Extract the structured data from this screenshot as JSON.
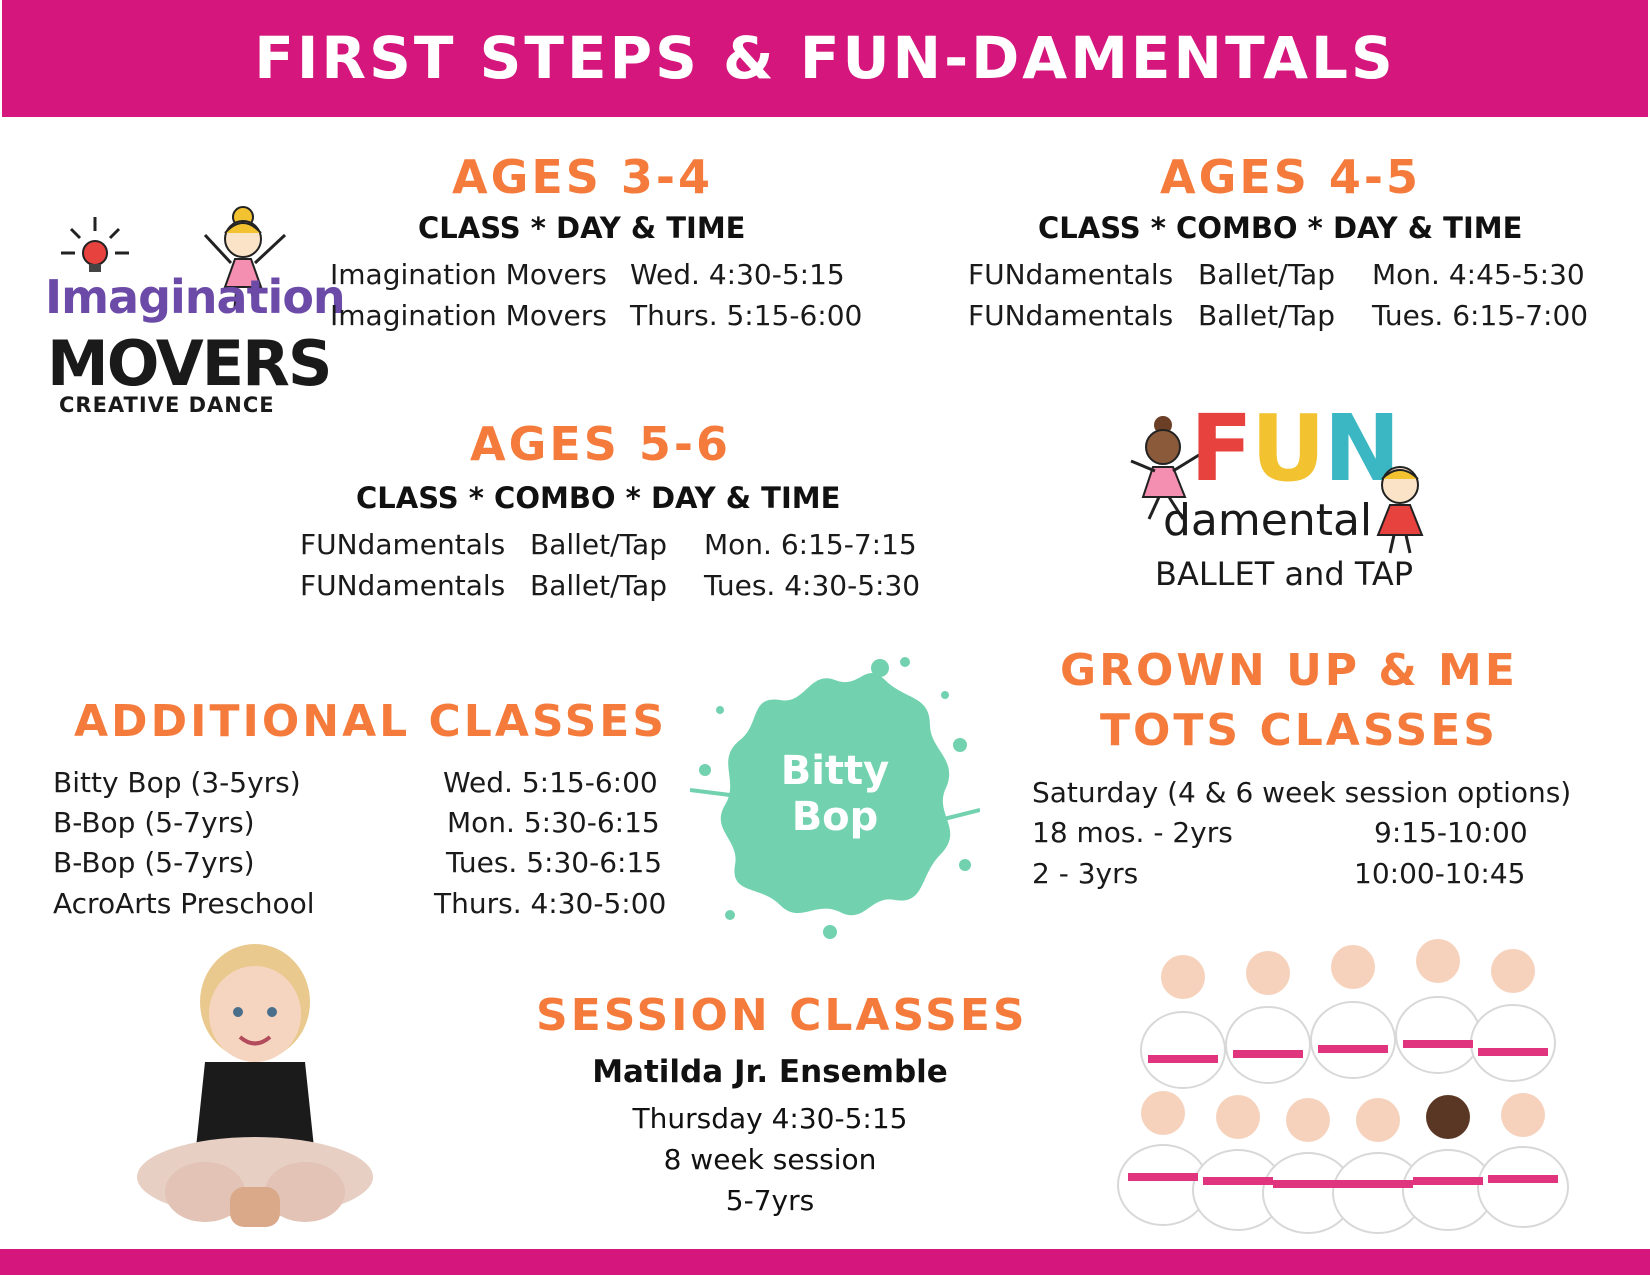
{
  "header": {
    "title": "FIRST STEPS & FUN-DAMENTALS"
  },
  "ages34": {
    "heading": "AGES 3-4",
    "subheading": "CLASS * DAY & TIME",
    "rows": [
      {
        "class": "Imagination Movers",
        "day_time": "Wed. 4:30-5:15"
      },
      {
        "class": "Imagination Movers",
        "day_time": "Thurs. 5:15-6:00"
      }
    ]
  },
  "ages45": {
    "heading": "AGES 4-5",
    "subheading": "CLASS * COMBO * DAY & TIME",
    "rows": [
      {
        "class": "FUNdamentals",
        "combo": "Ballet/Tap",
        "day_time": "Mon. 4:45-5:30"
      },
      {
        "class": "FUNdamentals",
        "combo": "Ballet/Tap",
        "day_time": "Tues. 6:15-7:00"
      }
    ]
  },
  "ages56": {
    "heading": "AGES 5-6",
    "subheading": "CLASS * COMBO * DAY & TIME",
    "rows": [
      {
        "class": "FUNdamentals",
        "combo": "Ballet/Tap",
        "day_time": "Mon. 6:15-7:15"
      },
      {
        "class": "FUNdamentals",
        "combo": "Ballet/Tap",
        "day_time": "Tues. 4:30-5:30"
      }
    ]
  },
  "additional": {
    "heading": "ADDITIONAL CLASSES",
    "rows": [
      {
        "class": "Bitty Bop (3-5yrs)",
        "day_time": "Wed. 5:15-6:00"
      },
      {
        "class": "B-Bop (5-7yrs)",
        "day_time": "Mon. 5:30-6:15"
      },
      {
        "class": "B-Bop (5-7yrs)",
        "day_time": "Tues. 5:30-6:15"
      },
      {
        "class": "AcroArts Preschool",
        "day_time": "Thurs. 4:30-5:00"
      }
    ]
  },
  "grownup": {
    "heading_line1": "GROWN UP & ME",
    "heading_line2": "TOTS CLASSES",
    "note": "Saturday (4 & 6 week session options)",
    "rows": [
      {
        "age": "18 mos. - 2yrs",
        "time": "9:15-10:00"
      },
      {
        "age": "2 - 3yrs",
        "time": "10:00-10:45"
      }
    ]
  },
  "session": {
    "heading": "SESSION CLASSES",
    "name": "Matilda Jr. Ensemble",
    "day_time": "Thursday 4:30-5:15",
    "length": "8 week session",
    "ages": "5-7yrs"
  },
  "logos": {
    "imagination": {
      "line1": "Imagination",
      "line2": "MOVERS",
      "line3": "CREATIVE DANCE"
    },
    "fundamentals": {
      "word": [
        "F",
        "U",
        "N"
      ],
      "line2": "damental",
      "line3": "BALLET and TAP"
    },
    "bitty_bop": {
      "line1": "Bitty",
      "line2": "Bop"
    }
  },
  "colors": {
    "brand_pink": "#d4167d",
    "heading_orange": "#f47b3b",
    "splash_mint": "#72d2b0",
    "logo_purple": "#6b4aa8",
    "fun_red": "#e8423f",
    "fun_yellow": "#f2c230",
    "fun_teal": "#3bb7c4"
  }
}
